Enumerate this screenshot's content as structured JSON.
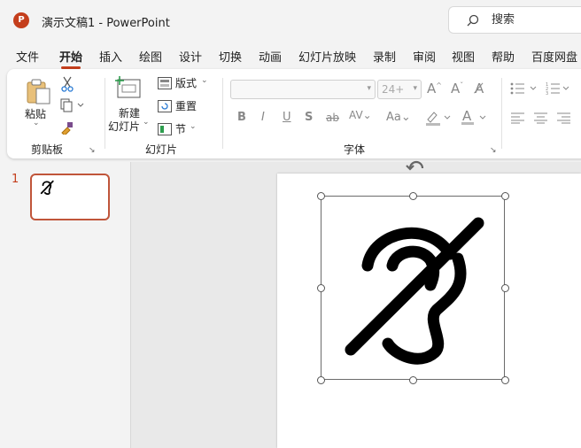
{
  "window": {
    "app_logo": "P",
    "title": "演示文稿1  -  PowerPoint",
    "search_placeholder": "搜索"
  },
  "tabs": [
    {
      "label": "文件"
    },
    {
      "label": "开始",
      "active": true
    },
    {
      "label": "插入"
    },
    {
      "label": "绘图"
    },
    {
      "label": "设计"
    },
    {
      "label": "切换"
    },
    {
      "label": "动画"
    },
    {
      "label": "幻灯片放映"
    },
    {
      "label": "录制"
    },
    {
      "label": "审阅"
    },
    {
      "label": "视图"
    },
    {
      "label": "帮助"
    },
    {
      "label": "百度网盘"
    }
  ],
  "ribbon": {
    "clipboard": {
      "paste_label": "粘贴",
      "group_label": "剪贴板"
    },
    "slides": {
      "new_slide_line1": "新建",
      "new_slide_line2": "幻灯片",
      "layout_label": "版式",
      "reset_label": "重置",
      "section_label": "节",
      "group_label": "幻灯片"
    },
    "font": {
      "font_name_value": "",
      "font_size_value": "24+",
      "group_label": "字体"
    }
  },
  "thumbnails": [
    {
      "number": "1"
    }
  ],
  "colors": {
    "accent": "#c43e1c",
    "selection_border": "#c0553a"
  },
  "icons": {
    "slide_graphic": "hearing-disabled-icon"
  }
}
